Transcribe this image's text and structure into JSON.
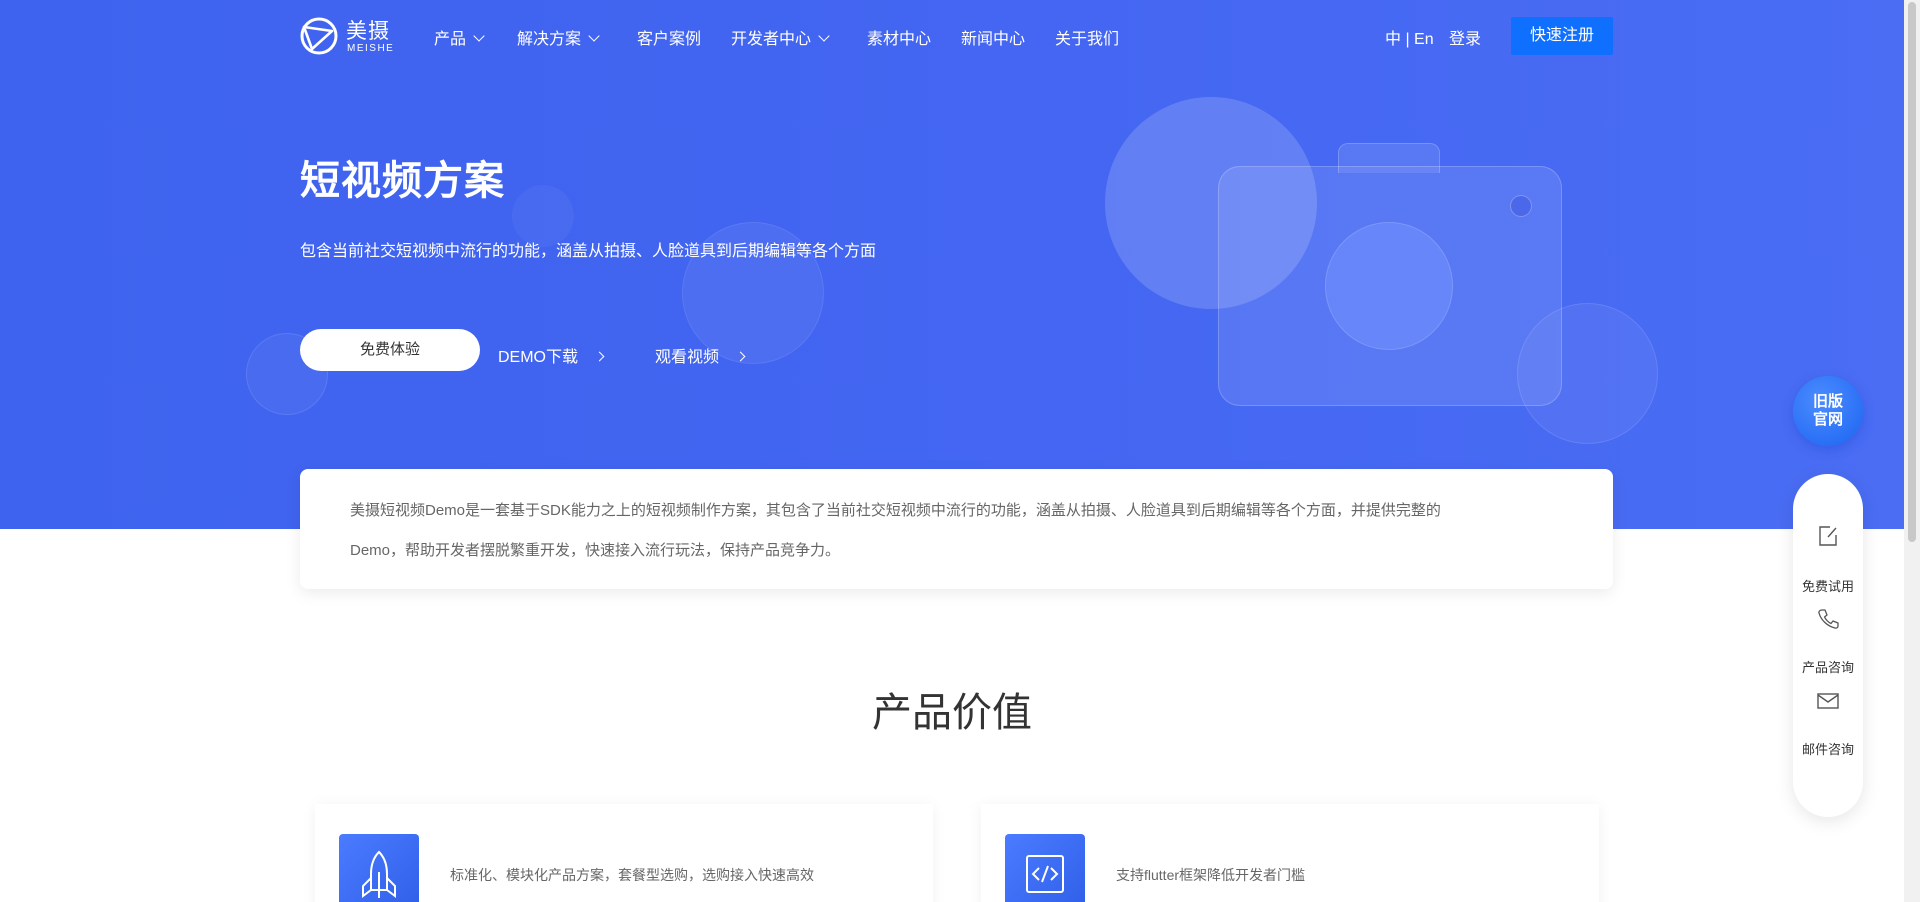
{
  "nav": {
    "logo_name": "美摄",
    "logo_sub": "MEISHE",
    "items": [
      {
        "label": "产品",
        "has_dropdown": true
      },
      {
        "label": "解决方案",
        "has_dropdown": true
      },
      {
        "label": "客户案例",
        "has_dropdown": false
      },
      {
        "label": "开发者中心",
        "has_dropdown": true
      },
      {
        "label": "素材中心",
        "has_dropdown": false
      },
      {
        "label": "新闻中心",
        "has_dropdown": false
      },
      {
        "label": "关于我们",
        "has_dropdown": false
      }
    ],
    "lang": "中 | En",
    "login": "登录",
    "register": "快速注册"
  },
  "hero": {
    "title": "短视频方案",
    "subtitle": "包含当前社交短视频中流行的功能，涵盖从拍摄、人脸道具到后期编辑等各个方面",
    "primary_button": "免费体验",
    "demo_link": "DEMO下载",
    "video_link": "观看视频"
  },
  "intro": {
    "line1": "美摄短视频Demo是一套基于SDK能力之上的短视频制作方案，其包含了当前社交短视频中流行的功能，涵盖从拍摄、人脸道具到后期编辑等各个方面，并提供完整的",
    "line2": "Demo，帮助开发者摆脱繁重开发，快速接入流行玩法，保持产品竞争力。"
  },
  "value": {
    "title": "产品价值",
    "cards": [
      {
        "icon": "rocket-icon",
        "text": "标准化、模块化产品方案，套餐型选购，选购接入快速高效"
      },
      {
        "icon": "code-icon",
        "text": "支持flutter框架降低开发者门槛"
      }
    ]
  },
  "float": {
    "old_site_line1": "旧版",
    "old_site_line2": "官网",
    "items": [
      {
        "icon": "edit-icon",
        "label": "免费试用"
      },
      {
        "icon": "phone-icon",
        "label": "产品咨询"
      },
      {
        "icon": "mail-icon",
        "label": "邮件咨询"
      }
    ]
  },
  "colors": {
    "hero_bg": "#4466f2",
    "register_bg": "#0f6fff",
    "accent": "#2f5fe8"
  }
}
